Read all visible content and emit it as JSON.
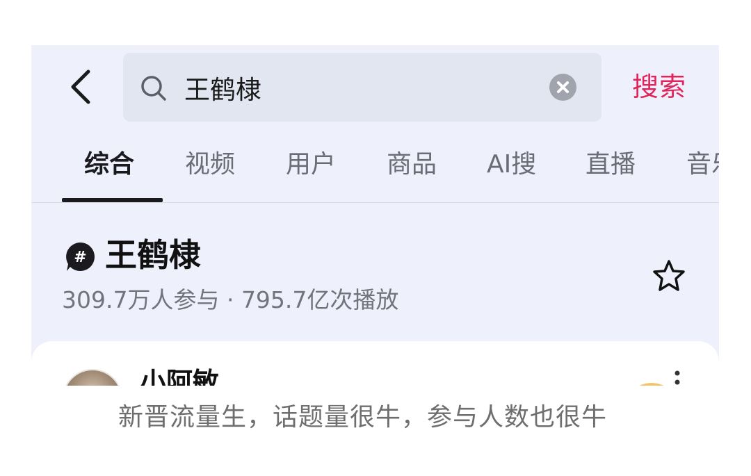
{
  "search": {
    "query": "王鹤棣",
    "submit_label": "搜索"
  },
  "tabs": [
    {
      "label": "综合",
      "active": true
    },
    {
      "label": "视频",
      "active": false
    },
    {
      "label": "用户",
      "active": false
    },
    {
      "label": "商品",
      "active": false
    },
    {
      "label": "AI搜",
      "active": false
    },
    {
      "label": "直播",
      "active": false
    },
    {
      "label": "音乐",
      "active": false
    }
  ],
  "topic": {
    "title": "王鹤棣",
    "stats": "309.7万人参与 · 795.7亿次播放",
    "icon": "hashtag-icon",
    "favorite_icon": "star-icon"
  },
  "post": {
    "author": "小阿敏"
  },
  "caption": "新晋流量生，话题量很牛，参与人数也很牛",
  "colors": {
    "accent": "#e3245a",
    "background": "#eef1fb",
    "search_box": "#e2e6f1",
    "text_primary": "#111111",
    "text_secondary": "#71747c"
  }
}
